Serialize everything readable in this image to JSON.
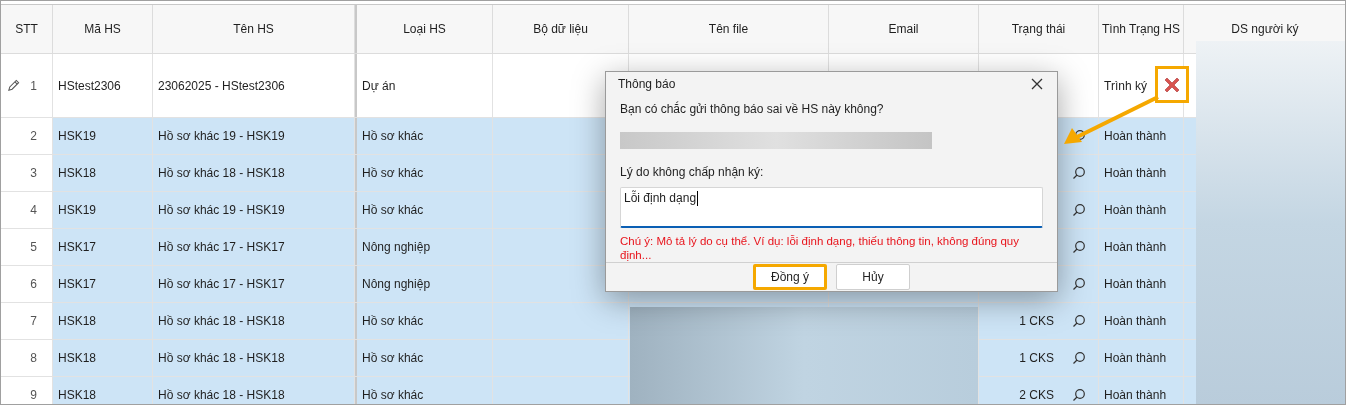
{
  "table": {
    "columns": [
      "STT",
      "Mã HS",
      "Tên HS",
      "Loại HS",
      "Bộ dữ liệu",
      "Tên file",
      "Email",
      "Trạng thái",
      "Tình Trạng HS",
      "DS người ký"
    ],
    "rows": [
      {
        "stt": "1",
        "ma_hs": "HStest2306",
        "ten_hs": "23062025 - HStest2306",
        "loai_hs": "Dự án",
        "tinh_trang_hs": "Trình ký",
        "editing": true,
        "selected": false
      },
      {
        "stt": "2",
        "ma_hs": "HSK19",
        "ten_hs": "Hồ sơ khác 19 - HSK19",
        "loai_hs": "Hồ sơ khác",
        "tinh_trang_hs": "Hoàn thành",
        "editing": false,
        "selected": true
      },
      {
        "stt": "3",
        "ma_hs": "HSK18",
        "ten_hs": "Hồ sơ khác 18 - HSK18",
        "loai_hs": "Hồ sơ khác",
        "tinh_trang_hs": "Hoàn thành",
        "editing": false,
        "selected": true
      },
      {
        "stt": "4",
        "ma_hs": "HSK19",
        "ten_hs": "Hồ sơ khác 19 - HSK19",
        "loai_hs": "Hồ sơ khác",
        "tinh_trang_hs": "Hoàn thành",
        "editing": false,
        "selected": true
      },
      {
        "stt": "5",
        "ma_hs": "HSK17",
        "ten_hs": "Hồ sơ khác 17 - HSK17",
        "loai_hs": "Nông nghiệp",
        "tinh_trang_hs": "Hoàn thành",
        "editing": false,
        "selected": true
      },
      {
        "stt": "6",
        "ma_hs": "HSK17",
        "ten_hs": "Hồ sơ khác 17 - HSK17",
        "loai_hs": "Nông nghiệp",
        "tinh_trang_hs": "Hoàn thành",
        "editing": false,
        "selected": true
      },
      {
        "stt": "7",
        "ma_hs": "HSK18",
        "ten_hs": "Hồ sơ khác 18 - HSK18",
        "loai_hs": "Hồ sơ khác",
        "trang_thai": "1 CKS",
        "tinh_trang_hs": "Hoàn thành",
        "editing": false,
        "selected": true
      },
      {
        "stt": "8",
        "ma_hs": "HSK18",
        "ten_hs": "Hồ sơ khác 18 - HSK18",
        "loai_hs": "Hồ sơ khác",
        "trang_thai": "1 CKS",
        "tinh_trang_hs": "Hoàn thành",
        "editing": false,
        "selected": true
      },
      {
        "stt": "9",
        "ma_hs": "HSK18",
        "ten_hs": "Hồ sơ khác 18 - HSK18",
        "loai_hs": "Hồ sơ khác",
        "trang_thai": "2 CKS",
        "tinh_trang_hs": "Hoàn thành",
        "editing": false,
        "selected": true
      }
    ]
  },
  "dialog": {
    "title": "Thông báo",
    "message": "Bạn có chắc gửi thông báo sai về HS này không?",
    "reason_label": "Lý do không chấp nhận ký:",
    "reason_value": "Lỗi định dạng",
    "note": "Chú ý: Mô tả lý do cụ thể. Ví dụ: lỗi định dạng, thiếu thông tin, không đúng quy định...",
    "buttons": [
      {
        "label": "Đồng ý",
        "highlighted": true
      },
      {
        "label": "Hủy",
        "highlighted": false
      }
    ]
  }
}
